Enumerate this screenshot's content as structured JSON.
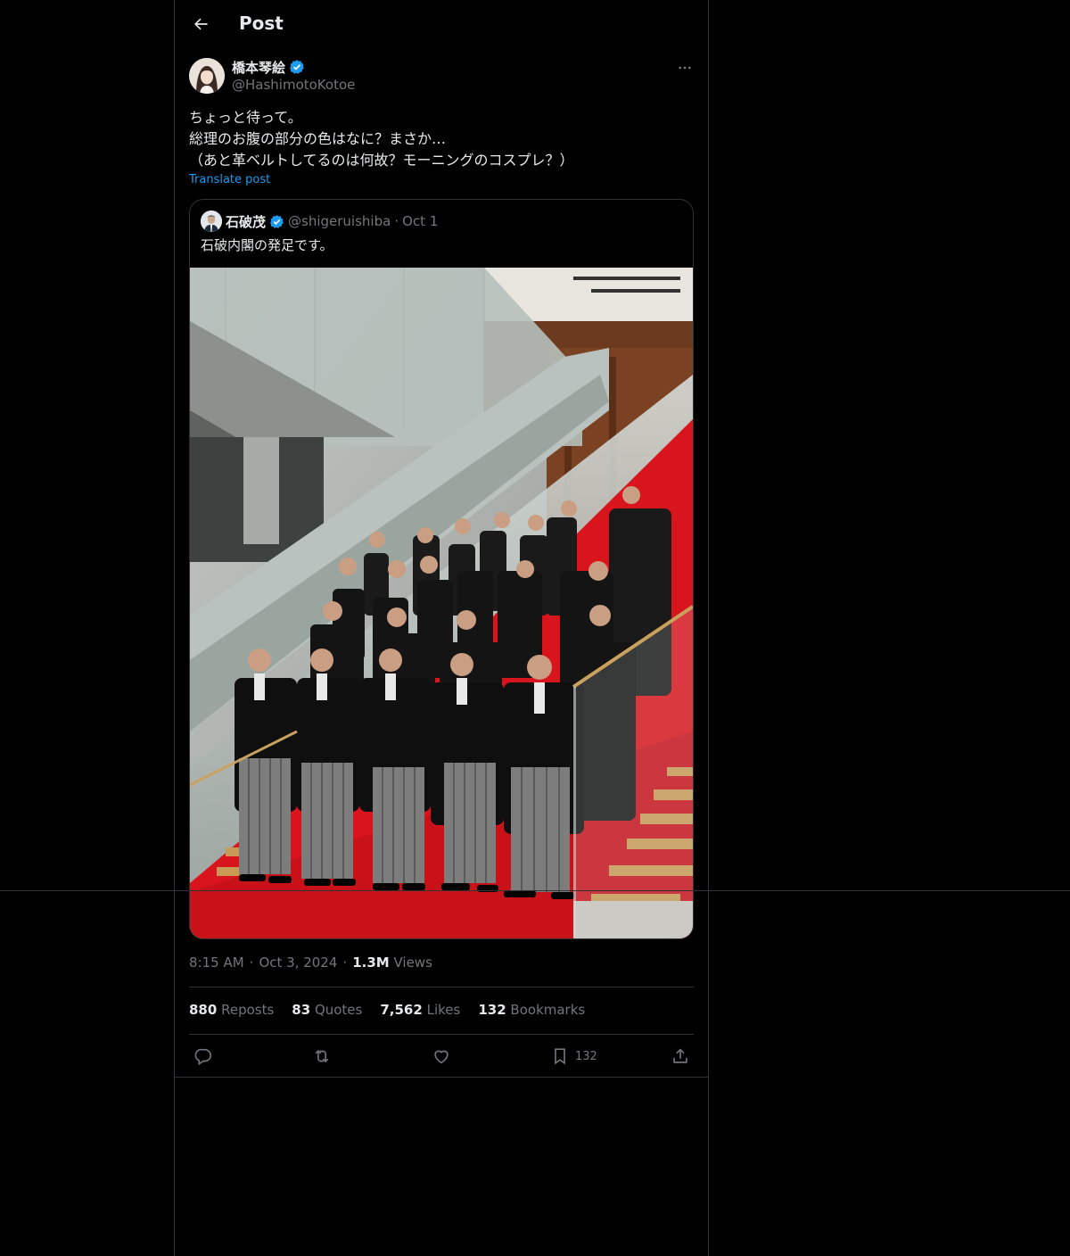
{
  "header": {
    "title": "Post",
    "back_icon": "arrow-left-icon"
  },
  "author": {
    "name": "橋本琴絵",
    "handle": "@HashimotoKotoe",
    "verified_color": "#1d9bf0"
  },
  "post": {
    "lines": [
      "ちょっと待って。",
      "総理のお腹の部分の色はなに？まさか…",
      "（あと革ベルトしてるのは何故？モーニングのコスプレ？）"
    ],
    "translate_label": "Translate post"
  },
  "quote": {
    "name": "石破茂",
    "handle": "@shigeruishiba",
    "dot": "·",
    "date": "Oct 1",
    "text": "石破内閣の発足です。"
  },
  "meta": {
    "time": "8:15 AM",
    "sep1": "·",
    "date": "Oct 3, 2024",
    "sep2": "·",
    "views_count": "1.3M",
    "views_label": "Views"
  },
  "stats": {
    "reposts": {
      "n": "880",
      "label": "Reposts"
    },
    "quotes": {
      "n": "83",
      "label": "Quotes"
    },
    "likes": {
      "n": "7,562",
      "label": "Likes"
    },
    "bookmarks": {
      "n": "132",
      "label": "Bookmarks"
    }
  },
  "actions": {
    "bookmark_count": "132",
    "icons": [
      "reply-icon",
      "repost-icon",
      "like-icon",
      "bookmark-icon",
      "share-icon"
    ]
  },
  "colors": {
    "accent": "#1d9bf0",
    "muted": "#71767b",
    "border": "#2f3336",
    "carpet": "#d8141c"
  }
}
